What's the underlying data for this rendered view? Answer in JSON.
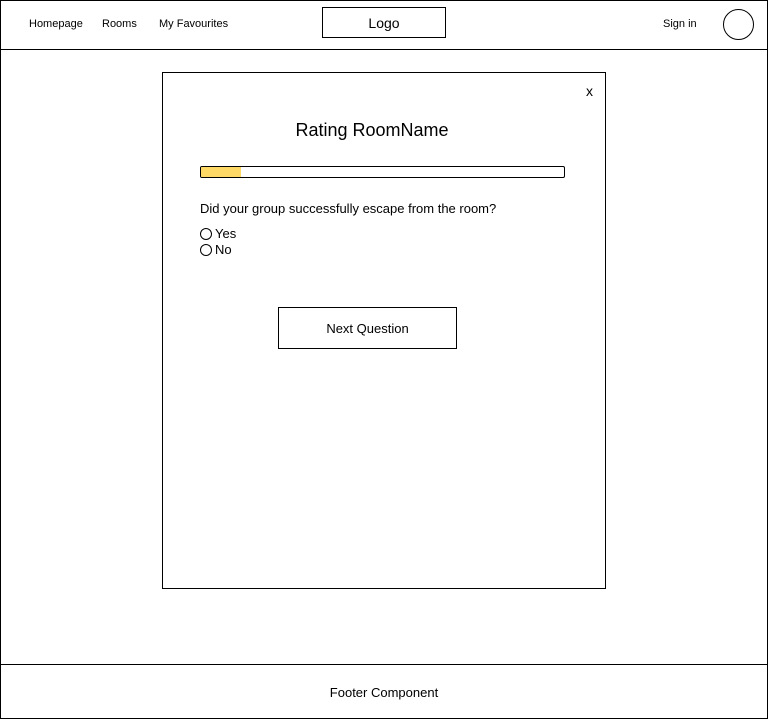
{
  "nav": {
    "homepage": "Homepage",
    "rooms": "Rooms",
    "favourites": "My Favourites",
    "logo": "Logo",
    "sign_in": "Sign in"
  },
  "modal": {
    "close": "x",
    "title": "Rating RoomName",
    "progress_fraction": 0.11,
    "progress_color": "#ffd966",
    "question": "Did your group successfully escape from the room?",
    "options": [
      {
        "label": "Yes",
        "selected": false
      },
      {
        "label": "No",
        "selected": false
      }
    ],
    "next_button": "Next Question"
  },
  "footer": {
    "label": "Footer Component"
  }
}
